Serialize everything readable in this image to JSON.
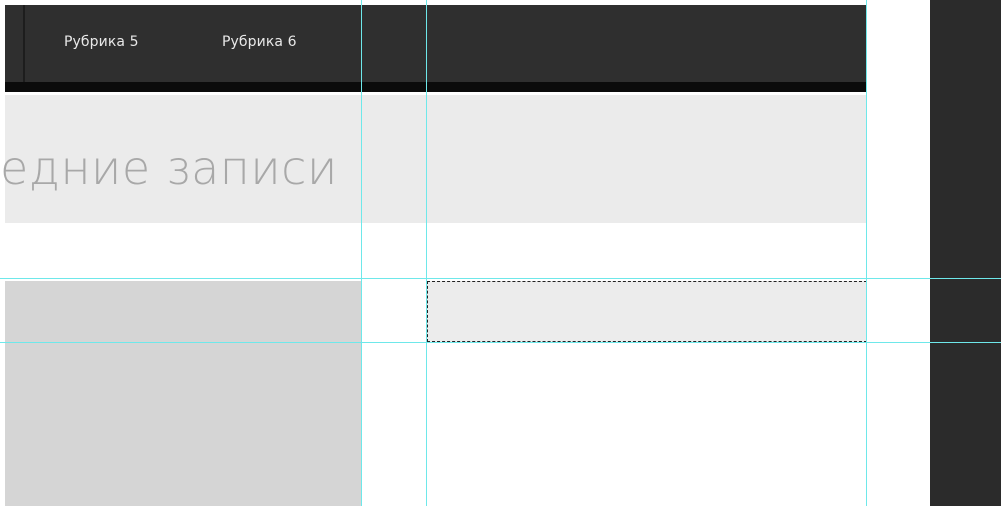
{
  "navbar": {
    "items": [
      {
        "label": "Рубрика 5"
      },
      {
        "label": "Рубрика 6"
      }
    ]
  },
  "section": {
    "title": "едние записи"
  },
  "colors": {
    "navbar_bg": "#2f2f2f",
    "header_bg": "#ebebeb",
    "guide": "#6ee8ea",
    "pasteboard": "#2b2b2b"
  }
}
